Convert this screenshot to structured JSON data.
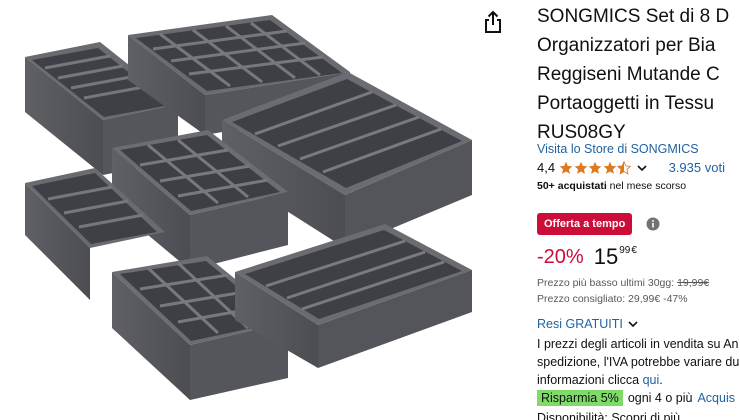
{
  "product": {
    "title_lines": [
      "SONGMICS Set di 8 D",
      "Organizzatori per Bia",
      "Reggiseni Mutande C",
      "Portaoggetti in Tessu",
      "RUS08GY"
    ],
    "store_link": "Visita lo Store di SONGMICS",
    "rating_value": "4,4",
    "rating_stars": 4.4,
    "votes": "3.935 voti",
    "bought_strong": "50+ acquistati",
    "bought_rest": " nel mese scorso"
  },
  "deal": {
    "badge": "Offerta a tempo",
    "info_icon": "info-icon"
  },
  "price": {
    "discount": "-20%",
    "whole": "15",
    "fraction": "99",
    "currency": "€",
    "lowest_label": "Prezzo più basso ultimi 30gg: ",
    "lowest_value": "19,99€",
    "recommended_label": "Prezzo consigliato: ",
    "recommended_value": "29,99€",
    "recommended_discount": " -47%"
  },
  "shipping": {
    "label": "Resi GRATUITI",
    "icon": "chevron-down-icon"
  },
  "tax_note": {
    "line1": "I prezzi degli articoli in vendita su An",
    "line2": "spedizione, l'IVA potrebbe variare du",
    "line3_text": "informazioni clicca ",
    "line3_link": "qui",
    "line3_end": "."
  },
  "savings": {
    "badge": "Risparmia 5%",
    "text": "ogni 4 o più",
    "link": "Acquis"
  },
  "bottom_partial": "Disponibilità: Scopri di più",
  "colors": {
    "deal_red": "#cc0c39",
    "link_blue": "#2162a1",
    "star_orange": "#de7921",
    "save_green": "#7fda69",
    "product_gray": "#5c5d62"
  },
  "icons": {
    "share": "share-icon"
  }
}
